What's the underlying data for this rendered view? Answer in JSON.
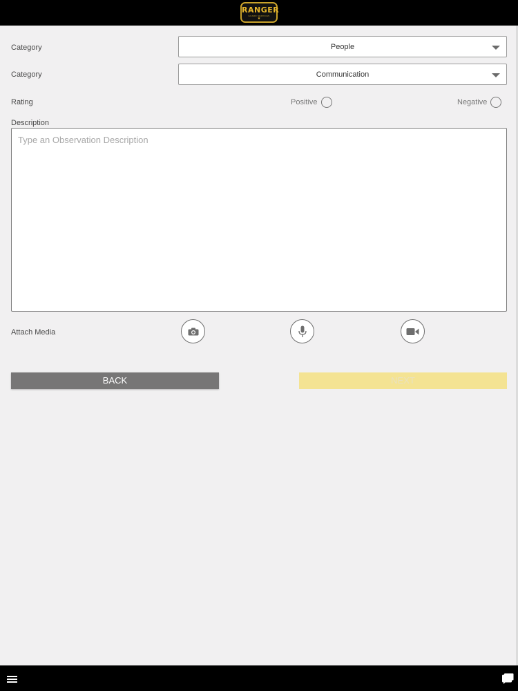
{
  "header": {
    "logo_text": "RANGER",
    "logo_subtext": "GUARD SERVICES",
    "logo_star": "★"
  },
  "form": {
    "category1": {
      "label": "Category",
      "value": "People"
    },
    "category2": {
      "label": "Category",
      "value": "Communication"
    },
    "rating": {
      "label": "Rating",
      "positive_label": "Positive",
      "negative_label": "Negative"
    },
    "description": {
      "label": "Description",
      "placeholder": "Type an Observation Description",
      "value": ""
    },
    "attach_media": {
      "label": "Attach Media"
    }
  },
  "buttons": {
    "back_label": "BACK",
    "next_label": "NEXT"
  },
  "colors": {
    "bar_background": "#000000",
    "page_background": "#f1f0f1",
    "back_button": "#777676",
    "next_button_disabled": "#f4e393",
    "logo_gold": "#e6b62c"
  },
  "icons": [
    "camera-icon",
    "microphone-icon",
    "video-camera-icon",
    "hamburger-menu-icon",
    "chat-icon"
  ]
}
